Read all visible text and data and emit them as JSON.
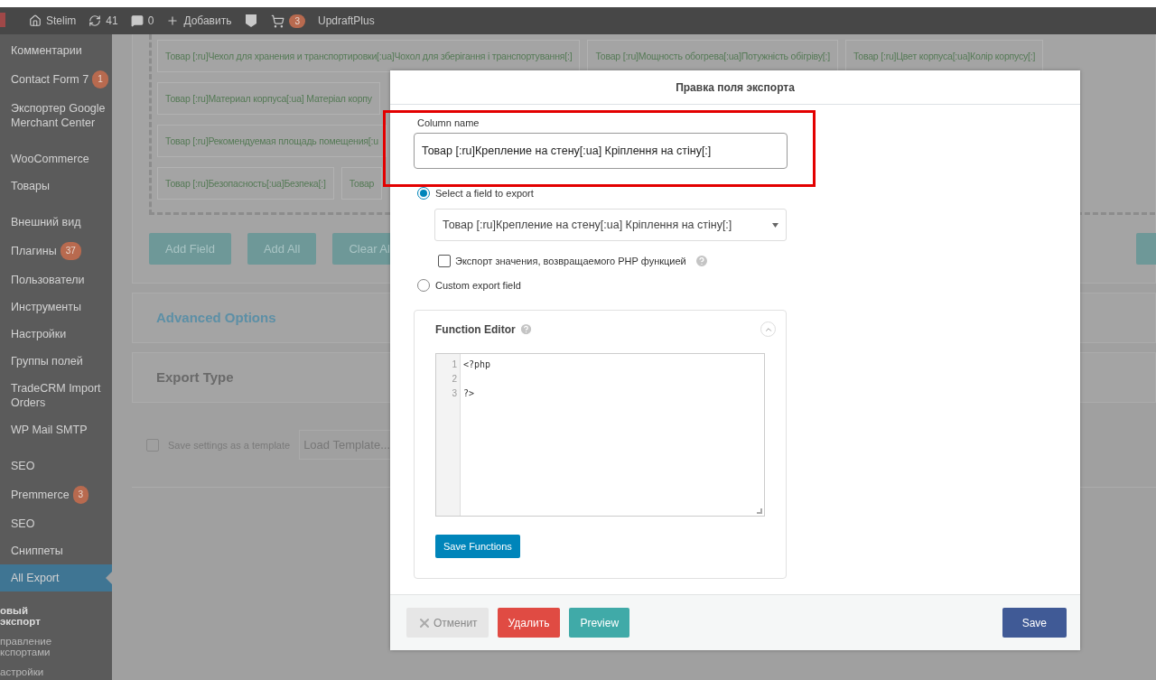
{
  "admin_bar": {
    "items": [
      {
        "kind": "site",
        "label": "Stelim"
      },
      {
        "kind": "updates",
        "label": "41"
      },
      {
        "kind": "comments",
        "label": "0"
      },
      {
        "kind": "new",
        "label": "Добавить"
      },
      {
        "kind": "seo"
      },
      {
        "kind": "cart",
        "badge": "3"
      },
      {
        "kind": "text",
        "label": "UpdraftPlus"
      }
    ]
  },
  "sidebar": {
    "groups": [
      [
        {
          "label": "Комментарии",
          "selected": false
        },
        {
          "label": "Contact Form 7",
          "badge": "1",
          "selected": false
        },
        {
          "label": "Экспортер Google Merchant Center",
          "selected": false
        }
      ],
      [
        {
          "label": "WooCommerce",
          "selected": false
        },
        {
          "label": "Товары",
          "selected": false
        }
      ],
      [
        {
          "label": "Внешний вид",
          "selected": false
        },
        {
          "label": "Плагины",
          "badge": "37",
          "selected": false
        },
        {
          "label": "Пользователи",
          "selected": false
        },
        {
          "label": "Инструменты",
          "selected": false
        },
        {
          "label": "Настройки",
          "selected": false
        },
        {
          "label": "Группы полей",
          "selected": false
        },
        {
          "label": "TradeCRM Import Orders",
          "selected": false
        },
        {
          "label": "WP Mail SMTP",
          "selected": false
        }
      ],
      [
        {
          "label": "SEO",
          "selected": false
        },
        {
          "label": "Premmerce",
          "badge": "3",
          "selected": false
        },
        {
          "label": "SEO",
          "selected": false
        },
        {
          "label": "Сниппеты",
          "selected": false
        },
        {
          "label": "All Export",
          "selected": true
        }
      ]
    ],
    "submenu": [
      {
        "label": "овый экспорт",
        "selected": true
      },
      {
        "label": "правление кспортами",
        "selected": false
      },
      {
        "label": "астройки",
        "selected": false
      }
    ]
  },
  "fields": {
    "rows": [
      {
        "chips": [
          "Товар [:ru]Чехол для хранения и транспортировки[:ua]Чохол для зберігання і транспортування[:]",
          "Товар [:ru]Мощность обогрева[:ua]Потужність обігріву[:]",
          "Товар [:ru]Цвет корпуса[:ua]Колір корпусу[:]"
        ]
      },
      {
        "chips": [
          "Товар [:ru]Материал корпуса[:ua] Матеріал корпу"
        ]
      },
      {
        "chips": [
          "Товар [:ru]Рекомендуемая площадь помещения[:u"
        ]
      },
      {
        "chips": [
          "Товар [:ru]Безопасность[:ua]Безпека[:]",
          "Товар"
        ]
      }
    ],
    "buttons": [
      "Add Field",
      "Add All",
      "Clear Al"
    ]
  },
  "advanced_options": {
    "title": "Advanced Options"
  },
  "export_type": {
    "title": "Export Type"
  },
  "template": {
    "checkbox": {
      "label": "Save settings as a template",
      "checked": false
    },
    "select": {
      "value": "Load Template..."
    }
  },
  "modal": {
    "title": "Правка поля экспорта",
    "column_name": {
      "label": "Column name",
      "value": "Товар [:ru]Крепление на стену[:ua] Кріплення на стіну[:]"
    },
    "source_options": [
      {
        "label": "Select a field to export",
        "selected": true
      },
      {
        "label": "Custom export field",
        "selected": false
      }
    ],
    "field_select": {
      "value": "Товар [:ru]Крепление на стену[:ua] Кріплення на стіну[:]"
    },
    "php_checkbox": {
      "label": "Экспорт значения, возвращаемого PHP функцией",
      "checked": false
    },
    "function_editor": {
      "title": "Function Editor",
      "expanded": true,
      "lines": [
        {
          "number": "1",
          "code": "<?php"
        },
        {
          "number": "2"
        },
        {
          "number": "3",
          "code": "?>"
        }
      ],
      "save_button": "Save Functions"
    },
    "footer": {
      "cancel": {
        "label": "Отменит",
        "disabled": true
      },
      "delete": "Удалить",
      "preview": "Preview",
      "save": "Save"
    }
  }
}
